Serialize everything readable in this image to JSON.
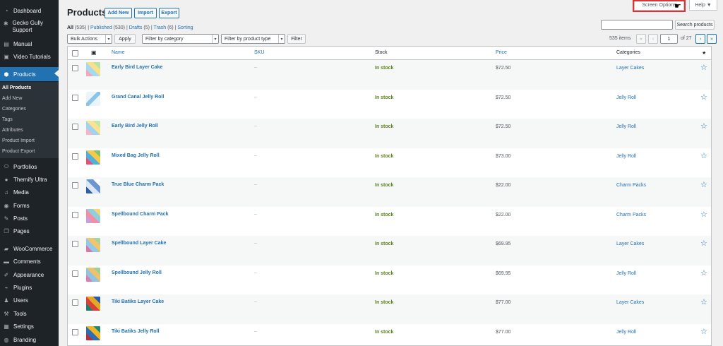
{
  "sidebar": {
    "items": [
      {
        "label": "Dashboard",
        "icon": "dashboard-icon",
        "glyph": "◔"
      },
      {
        "label": "Gecko Gully Support",
        "icon": "gecko-support-icon",
        "glyph": "✱"
      },
      {
        "label": "Manual",
        "icon": "manual-icon",
        "glyph": "▤"
      },
      {
        "label": "Video Tutorials",
        "icon": "video-tutorials-icon",
        "glyph": "▣"
      },
      {
        "label": "Products",
        "icon": "products-icon",
        "glyph": "⬢"
      },
      {
        "label": "Portfolios",
        "icon": "portfolios-icon",
        "glyph": "⬭"
      },
      {
        "label": "Themify Ultra",
        "icon": "themify-ultra-icon",
        "glyph": "●"
      },
      {
        "label": "Media",
        "icon": "media-icon",
        "glyph": "♫"
      },
      {
        "label": "Forms",
        "icon": "forms-icon",
        "glyph": "◉"
      },
      {
        "label": "Posts",
        "icon": "posts-icon",
        "glyph": "✎"
      },
      {
        "label": "Pages",
        "icon": "pages-icon",
        "glyph": "❐"
      },
      {
        "label": "WooCommerce",
        "icon": "woocommerce-icon",
        "glyph": "▰"
      },
      {
        "label": "Comments",
        "icon": "comments-icon",
        "glyph": "▬"
      },
      {
        "label": "Appearance",
        "icon": "appearance-icon",
        "glyph": "✐"
      },
      {
        "label": "Plugins",
        "icon": "plugins-icon",
        "glyph": "⌁"
      },
      {
        "label": "Users",
        "icon": "users-icon",
        "glyph": "♟"
      },
      {
        "label": "Tools",
        "icon": "tools-icon",
        "glyph": "⚒"
      },
      {
        "label": "Settings",
        "icon": "settings-icon",
        "glyph": "▦"
      },
      {
        "label": "Branding",
        "icon": "branding-icon",
        "glyph": "◍"
      }
    ],
    "submenu": [
      "All Products",
      "Add New",
      "Categories",
      "Tags",
      "Attributes",
      "Product Import",
      "Product Export"
    ]
  },
  "header": {
    "title": "Products",
    "add_new": "Add New",
    "import": "Import",
    "export": "Export",
    "screen_options": "Screen Options",
    "help": "Help ▼"
  },
  "views": {
    "all": "All",
    "all_count": "(535)",
    "published": "Published",
    "published_count": "(530)",
    "drafts": "Drafts",
    "drafts_count": "(5)",
    "trash": "Trash",
    "trash_count": "(6)",
    "sorting": "Sorting"
  },
  "filters": {
    "bulk_actions": "Bulk Actions",
    "apply": "Apply",
    "category": "Filter by category",
    "product_type": "Filter by product type",
    "filter": "Filter",
    "search_button": "Search products",
    "items": "535 items",
    "page": "1",
    "of_pages": "of 27"
  },
  "table": {
    "columns": {
      "name": "Name",
      "sku": "SKU",
      "stock": "Stock",
      "price": "Price",
      "categories": "Categories",
      "featured": "★"
    },
    "rows": [
      {
        "name": "Early Bird Layer Cake",
        "sku": "–",
        "stock": "In stock",
        "price": "$72.50",
        "category": "Layer Cakes"
      },
      {
        "name": "Grand Canal Jelly Roll",
        "sku": "–",
        "stock": "In stock",
        "price": "$72.50",
        "category": "Jelly Roll"
      },
      {
        "name": "Early Bird Jelly Roll",
        "sku": "–",
        "stock": "In stock",
        "price": "$72.50",
        "category": "Jelly Roll"
      },
      {
        "name": "Mixed Bag Jelly Roll",
        "sku": "–",
        "stock": "In stock",
        "price": "$73.00",
        "category": "Jelly Roll"
      },
      {
        "name": "True Blue Charm Pack",
        "sku": "–",
        "stock": "In stock",
        "price": "$22.00",
        "category": "Charm Packs"
      },
      {
        "name": "Spellbound Charm Pack",
        "sku": "–",
        "stock": "In stock",
        "price": "$22.00",
        "category": "Charm Packs"
      },
      {
        "name": "Spellbound Layer Cake",
        "sku": "–",
        "stock": "In stock",
        "price": "$69.95",
        "category": "Layer Cakes"
      },
      {
        "name": "Spellbound Jelly Roll",
        "sku": "–",
        "stock": "In stock",
        "price": "$69.95",
        "category": "Jelly Roll"
      },
      {
        "name": "Tiki Batiks Layer Cake",
        "sku": "–",
        "stock": "In stock",
        "price": "$77.00",
        "category": "Layer Cakes"
      },
      {
        "name": "Tiki Batiks Jelly Roll",
        "sku": "–",
        "stock": "In stock",
        "price": "$77.00",
        "category": "Jelly Roll"
      }
    ]
  },
  "icons": {
    "image_column": "image-icon",
    "star": "☆"
  },
  "colors": {
    "accent": "#2271b1",
    "in_stock": "#5b841b",
    "sidebar": "#1d2327",
    "highlight": "#d63638"
  }
}
